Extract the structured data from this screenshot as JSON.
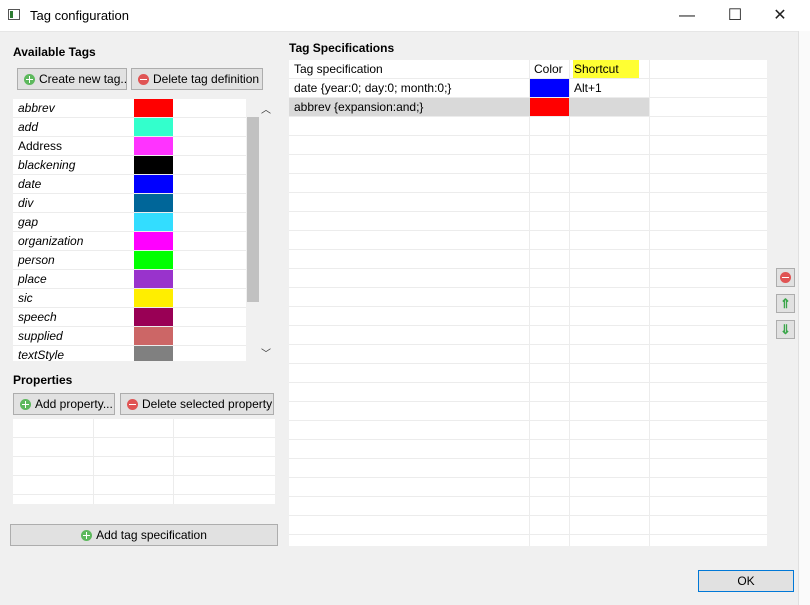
{
  "window": {
    "title": "Tag configuration",
    "minimize": "—",
    "maximize": "☐",
    "close": "✕"
  },
  "available_tags": {
    "title": "Available Tags",
    "create_label": "Create new tag...",
    "delete_label": "Delete tag definition",
    "tags": [
      {
        "name": "abbrev",
        "color": "#ff0000",
        "italic": true
      },
      {
        "name": "add",
        "color": "#33ffcc",
        "italic": true
      },
      {
        "name": "Address",
        "color": "#ff33ff",
        "italic": false
      },
      {
        "name": "blackening",
        "color": "#000000",
        "italic": true
      },
      {
        "name": "date",
        "color": "#0000ff",
        "italic": true
      },
      {
        "name": "div",
        "color": "#006699",
        "italic": true
      },
      {
        "name": "gap",
        "color": "#33ddff",
        "italic": true
      },
      {
        "name": "organization",
        "color": "#ff00ff",
        "italic": true
      },
      {
        "name": "person",
        "color": "#00ff00",
        "italic": true
      },
      {
        "name": "place",
        "color": "#9933cc",
        "italic": true
      },
      {
        "name": "sic",
        "color": "#ffee00",
        "italic": true
      },
      {
        "name": "speech",
        "color": "#990055",
        "italic": true
      },
      {
        "name": "supplied",
        "color": "#cc6666",
        "italic": true
      },
      {
        "name": "textStyle",
        "color": "#808080",
        "italic": true
      }
    ]
  },
  "properties": {
    "title": "Properties",
    "add_label": "Add property...",
    "delete_label": "Delete selected property"
  },
  "add_spec_label": "Add tag specification",
  "tag_specs": {
    "title": "Tag Specifications",
    "columns": [
      "Tag specification",
      "Color",
      "Shortcut"
    ],
    "rows": [
      {
        "spec": "date {year:0; day:0; month:0;}",
        "color": "#0000ff",
        "shortcut": "Alt+1"
      },
      {
        "spec": "abbrev {expansion:and;}",
        "color": "#ff0000",
        "shortcut": "",
        "selected": true
      }
    ]
  },
  "ok_label": "OK",
  "colors": {
    "highlight": "#ffff33",
    "selected_row": "#d9d9d9"
  }
}
